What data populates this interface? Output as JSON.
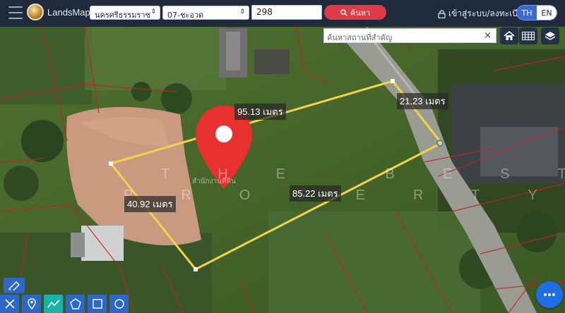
{
  "app": {
    "brand": "LandsMaps"
  },
  "search": {
    "province": "นครศรีธรรมราช",
    "district": "07-ชะอวด",
    "parcel_number": "298",
    "search_label": "ค้นหา"
  },
  "auth": {
    "login_label": "เข้าสู่ระบบ/ลงทะเบียน"
  },
  "language": {
    "th": "TH",
    "en": "EN",
    "active": "TH"
  },
  "place_search": {
    "placeholder": "ค้นหาสถานที่สำคัญ",
    "close": "×"
  },
  "map": {
    "measurements": {
      "top": "95.13 เมตร",
      "right": "21.23 เมตร",
      "bottom": "85.22 เมตร",
      "left": "40.92 เมตร"
    },
    "watermark_line1": "THE BEST",
    "watermark_line2": "PROPERTY",
    "parcel_label": "สำนักงานที่ดิน",
    "colors": {
      "parcel_outline": "#f2d44a",
      "boundary_lines": "#c22323",
      "pin": "#e8312f",
      "accent": "#2b68c9"
    }
  },
  "tools": {
    "icons": [
      "home-icon",
      "grid-icon",
      "layers-icon"
    ],
    "draw_icons": [
      "ruler-icon",
      "marker-icon",
      "line-icon",
      "polygon-icon",
      "rectangle-icon",
      "circle-icon"
    ],
    "more_icon": "more-icon"
  }
}
